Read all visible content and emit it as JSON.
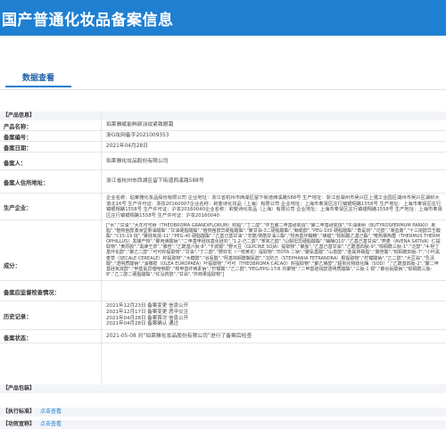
{
  "header": {
    "title": "国产普通化妆品备案信息"
  },
  "tabs": [
    {
      "label": "数据查看"
    }
  ],
  "product_info": {
    "section_title": "【产品信息】",
    "fields": {
      "product_name": {
        "label": "产品名称：",
        "value": "珀莱雅赋能鲜颜淡纹紧致眼霜"
      },
      "record_no": {
        "label": "备案编号：",
        "value": "浙G妆网备字2021009353"
      },
      "record_date": {
        "label": "备案日期：",
        "value": "2021年04月28日"
      },
      "registrant": {
        "label": "备案人：",
        "value": "珀莱雅化妆品股份有限公司"
      },
      "registrant_addr": {
        "label": "备案人住所地址：",
        "value": "浙江省杭州市西湖区留下街道西溪路588号"
      },
      "manufacturer": {
        "label": "生产企业：",
        "value": "企业名称：珀莱雅化妆品股份有限公司 企业地址：浙江省杭州市西湖区留下街道西溪路588号 生产地址：浙江省湖州市吴兴区上强工业园区湖州市吴兴区湖织大道北16号 生产许可证：浙妆20160007企业名称：莉斐诗化妆品（上海）有限公司 企业地址：上海市奉贤区庄行镇银翔路1558号 生产地址：上海市奉贤区庄行镇银翔路1558号 生产许可证：沪妆20160040企业名称：莉斐诗化妆品（上海）有限公司 企业地址：上海市奉贤区庄行镇银翔路1558号 生产地址：上海市奉贤区庄行镇银翔路1558号 生产许可证：沪妆20160040"
      },
      "ingredients": {
        "label": "成分：",
        "value": "[\"水\",\"甘油\",\"大花可可树（THEOBROMA GRANDIFLORUM）籽脂\",\"丁二醇\",\"环五聚二甲基硅氧烷\",\"聚二甲基硅氧烷\",\"牛油果树（BUTYROSPERMUM PARKII）果脂\",\"植物甾醇澳洲坚果油酸酯\",\"甘油硬脂酸酯\",\"植物甾醇异硬脂酸酯\",\"聚甘油-3二硬脂酸酯\",\"鲸蜡醇\",\"PEG-100 硬脂酸酯\",\"角鲨烷\",\"泛醇\",\"凝血酸\",\"十三烷醇异壬酸酯\",\"C15-19 烷\",\"聚硅氧烷-11\",\"PEG-40 硬脂酸酯\",\"乙基己基甘油\",\"辛酰/癸酰甘油三酯\",\"羟丙基环糊精\",\"蜂蜡\",\"棕榈酸乙基己酯\",\"嗜热栖热菌（THERMUS THERMOPHILLUS）发酵产物\",\"聚丙烯酸钠\",\"二甲基甲硅烷基化硅石\",\"1,2-己二醇\",\"苯氧乙醇\",\"山梨坦异硬脂酸酯\",\"辅酶Q10\",\"乙基己基甘油\",\"燕麦（AVENA SATIVA）仁提取物\",\"黄原胶\",\"黑蜂王浆\",\"腺苷\",\"乙酰基六肽-8\",\"卡波姆\",\"野大豆（GLYCINE SOJA）提取物\",\"聚肽\",\"乙基己基甘油\",\"乙酰基四肽-9\",\"棕榈酰三肽-1\",\"泛醇\",\"4-羟丁基环化醇\",\"聚乙二醇\",\"可可籽提取物\",\"甘油\",\"丁二醇\",\"野欢花（一枝黄花）提取物\",\"EDTA 二钠\",\"聚氨基酸\",\"山嵛醇\",\"金属卵磷脂\",\"腺苷酸\",\"棕榈酰四肽-7\",\"小叶黑麦草（SECALE CEREALE）籽提取物\",\"木糖醇\",\"谷氨酸\",\"羟基棕榈酰鞘氨醇\",\"汉防己（STEPHANIA TETRANDRA）根提取物\",\"柠檬酸钠\",\"乙二醇\",\"大豆油\",\"乳清酸\",\"透明质酸钠\",\"油橄榄（OLEA EUROPAEA）叶提取物\",\"可可（THEOBROMA CACAO）籽提取物\",\"聚乙烯醇\",\"超氧化物歧化酶（SOD）\",\"乙酰基四肽-2\",\"聚二甲基硅氧烷醇\",\"甲基氯异噻唑啉酮\",\"羧甲基纤维素钠\",\"柠檬酸\",\"乙二醇\",\"PEG/PPG-17/6 共聚物\",\"二甲基硅烷醇透明质酸酯\",\"三肽-1 铜\",\"聚谷氨酸钠\",\"棕榈酰三肽-8\",\"乙二醇二硬脂酸酯\",\"红没药醇\",\"甘油\",\"芹西果提取物\"]"
      },
      "post_regulation": {
        "label": "备案后监督检查情况：",
        "value": ""
      },
      "history": {
        "label": "历史记录：",
        "lines": [
          "2021年12月23日 备案变更 信息公开",
          "2021年12月17日 备案变更 恶伞仪注",
          "2021年04月28日 备案首次 信息公开",
          "2021年04月28日 备案确认 通过"
        ]
      },
      "status": {
        "label": "备案状态：",
        "value": "2021-05-08 对“珀莱雅化妆品股份有限公司”进行了备案后检查"
      }
    }
  },
  "packaging": {
    "section_title": "【产品包装】"
  },
  "exec_std": {
    "section_title": "【执行标准】",
    "link": "点击查看"
  },
  "efficacy": {
    "section_title": "【功效宣称】",
    "link": "点击查看"
  }
}
